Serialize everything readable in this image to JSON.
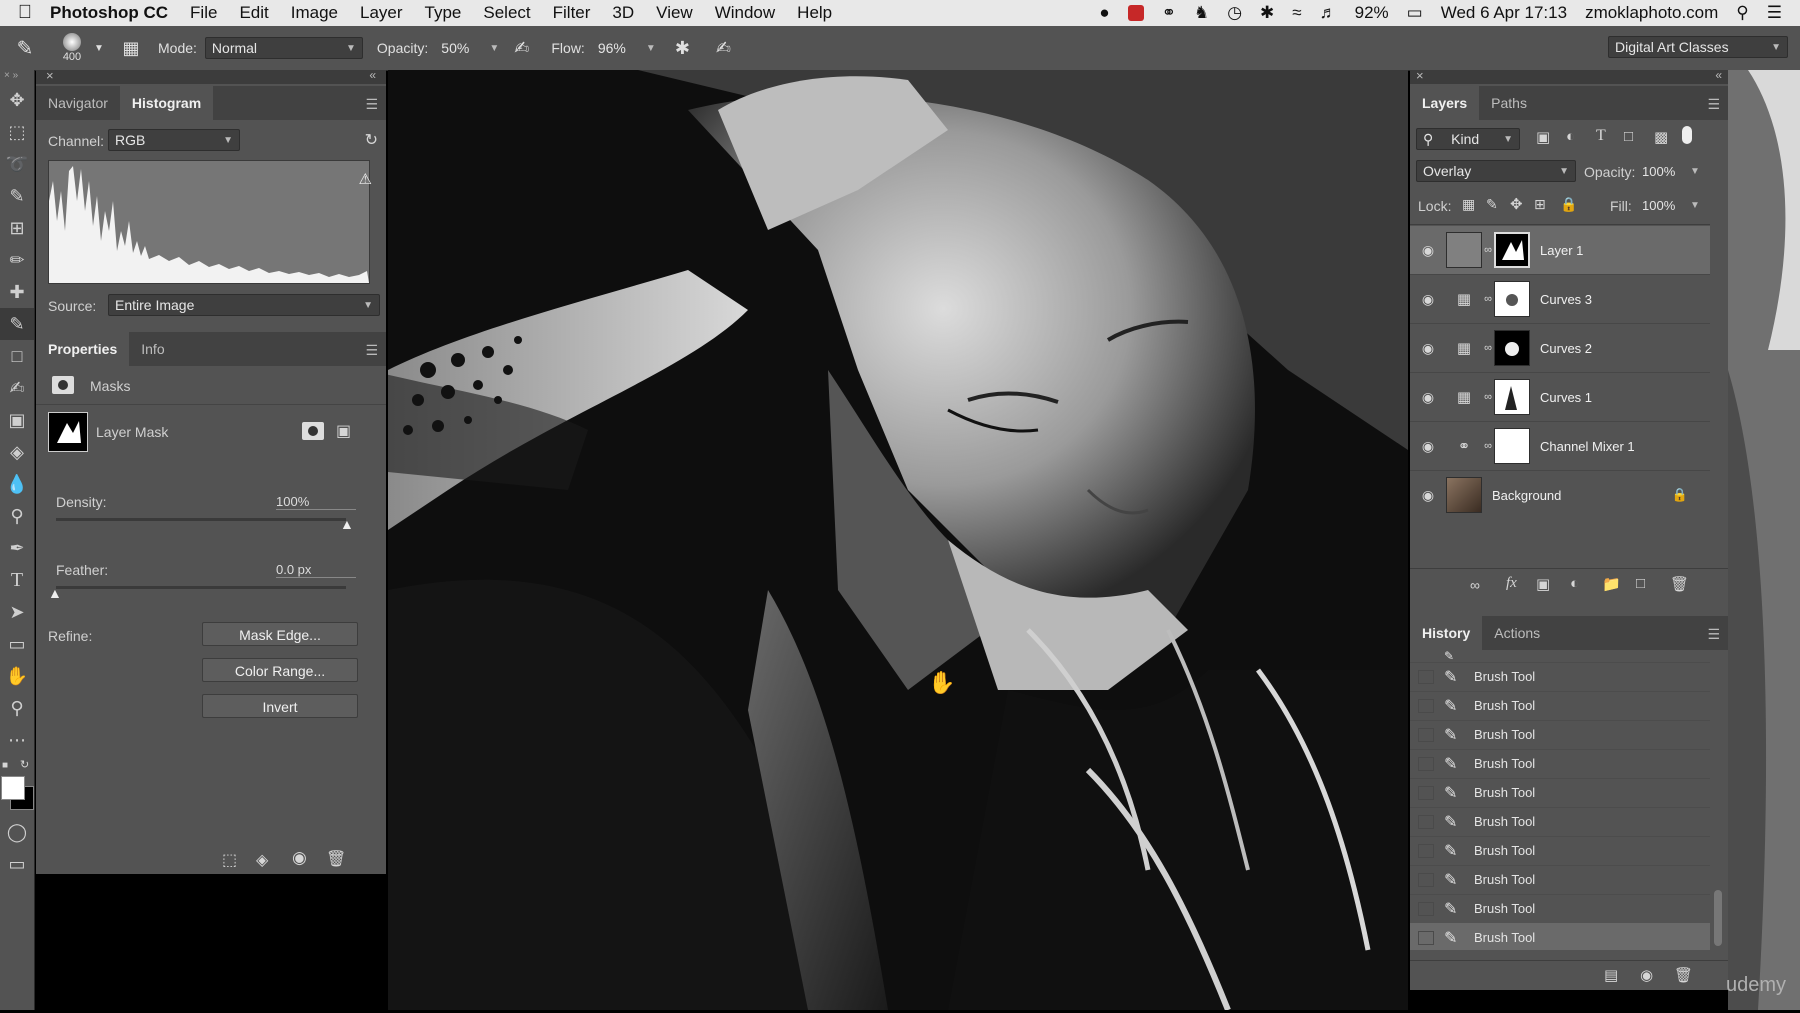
{
  "menubar": {
    "app_name": "Photoshop CC",
    "items": [
      "File",
      "Edit",
      "Image",
      "Layer",
      "Type",
      "Select",
      "Filter",
      "3D",
      "View",
      "Window",
      "Help"
    ],
    "battery": "92%",
    "datetime": "Wed 6 Apr  17:13",
    "site": "zmoklaphoto.com"
  },
  "options": {
    "brush_size": "400",
    "mode_label": "Mode:",
    "mode_value": "Normal",
    "opacity_label": "Opacity:",
    "opacity_value": "50%",
    "flow_label": "Flow:",
    "flow_value": "96%",
    "workspace": "Digital Art Classes"
  },
  "navigator_panel": {
    "tabs": [
      "Navigator",
      "Histogram"
    ],
    "channel_label": "Channel:",
    "channel_value": "RGB",
    "source_label": "Source:",
    "source_value": "Entire Image"
  },
  "properties_panel": {
    "tabs": [
      "Properties",
      "Info"
    ],
    "section": "Masks",
    "mask_type": "Layer Mask",
    "density_label": "Density:",
    "density_value": "100%",
    "density_level": 1.0,
    "feather_label": "Feather:",
    "feather_value": "0.0 px",
    "feather_level": 0.0,
    "refine_label": "Refine:",
    "buttons": [
      "Mask Edge...",
      "Color Range...",
      "Invert"
    ]
  },
  "layers_panel": {
    "tabs": [
      "Layers",
      "Paths"
    ],
    "filter_value": "Kind",
    "blend_mode": "Overlay",
    "opacity_label": "Opacity:",
    "opacity_value": "100%",
    "lock_label": "Lock:",
    "fill_label": "Fill:",
    "fill_value": "100%",
    "layers": [
      {
        "name": "Layer 1"
      },
      {
        "name": "Curves 3"
      },
      {
        "name": "Curves 2"
      },
      {
        "name": "Curves 1"
      },
      {
        "name": "Channel Mixer 1"
      },
      {
        "name": "Background"
      }
    ]
  },
  "history_panel": {
    "tabs": [
      "History",
      "Actions"
    ],
    "items": [
      "Brush Tool",
      "Brush Tool",
      "Brush Tool",
      "Brush Tool",
      "Brush Tool",
      "Brush Tool",
      "Brush Tool",
      "Brush Tool",
      "Brush Tool",
      "Brush Tool"
    ]
  },
  "watermark": "udemy",
  "colors": {
    "panel": "#535353",
    "panel_dark": "#424242",
    "menubar": "#e8e8e8",
    "selected_row": "#6a6a6a"
  }
}
